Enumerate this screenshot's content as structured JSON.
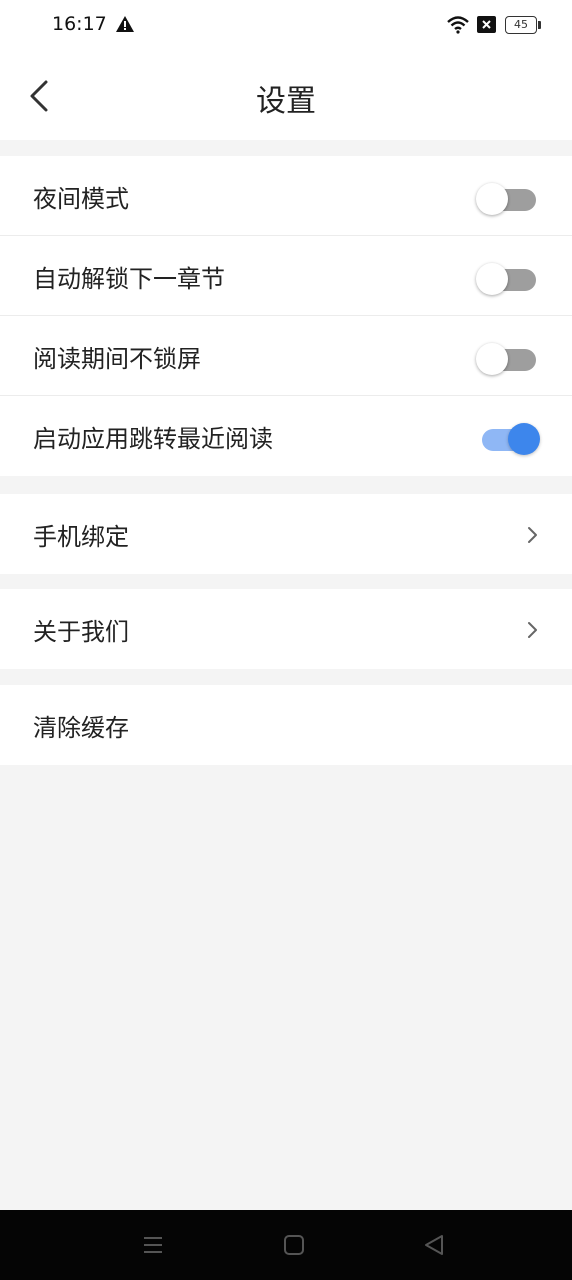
{
  "status_bar": {
    "time": "16:17",
    "battery": "45",
    "icons": [
      "warning-icon",
      "wifi-icon",
      "sim-off-icon",
      "battery-icon"
    ]
  },
  "header": {
    "title": "设置",
    "back_icon": "back-arrow-icon"
  },
  "settings": {
    "toggles": [
      {
        "label": "夜间模式",
        "on": false
      },
      {
        "label": "自动解锁下一章节",
        "on": false
      },
      {
        "label": "阅读期间不锁屏",
        "on": false
      },
      {
        "label": "启动应用跳转最近阅读",
        "on": true
      }
    ],
    "links": [
      {
        "label": "手机绑定",
        "icon": "chevron-right-icon"
      },
      {
        "label": "关于我们",
        "icon": "chevron-right-icon"
      },
      {
        "label": "清除缓存"
      }
    ]
  },
  "colors": {
    "accent": "#3d86ec",
    "accent_track": "#8fb7f5",
    "toggle_off_track": "#9e9e9e",
    "background": "#f4f4f4"
  },
  "nav_bar": {
    "icons": [
      "menu-icon",
      "home-icon",
      "back-triangle-icon"
    ]
  }
}
